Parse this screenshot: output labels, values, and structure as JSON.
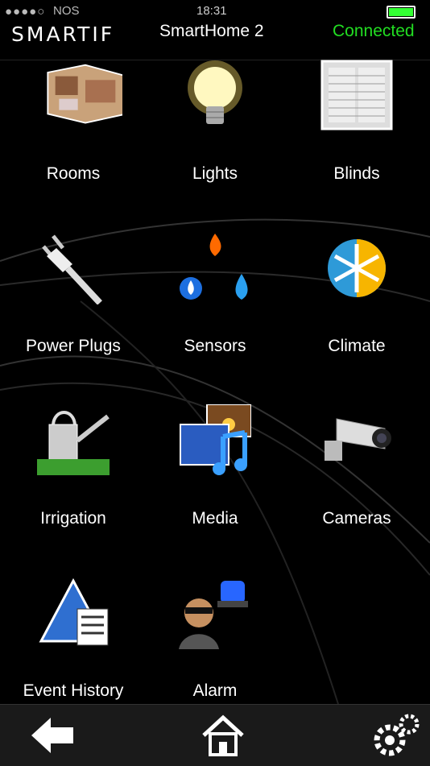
{
  "status_bar": {
    "signal": "●●●●○",
    "carrier": "NOS",
    "time": "18:31"
  },
  "header": {
    "logo": "SMARTIF",
    "title": "SmartHome 2",
    "connection": "Connected"
  },
  "tiles": [
    {
      "label": "Rooms",
      "icon": "floorplan-icon"
    },
    {
      "label": "Lights",
      "icon": "lightbulb-icon"
    },
    {
      "label": "Blinds",
      "icon": "window-blinds-icon"
    },
    {
      "label": "Power Plugs",
      "icon": "power-plug-icon"
    },
    {
      "label": "Sensors",
      "icon": "sensors-icon"
    },
    {
      "label": "Climate",
      "icon": "climate-icon"
    },
    {
      "label": "Irrigation",
      "icon": "watering-can-icon"
    },
    {
      "label": "Media",
      "icon": "media-icon"
    },
    {
      "label": "Cameras",
      "icon": "security-camera-icon"
    },
    {
      "label": "Event History",
      "icon": "event-history-icon"
    },
    {
      "label": "Alarm",
      "icon": "alarm-icon"
    }
  ],
  "footer": {
    "back": "back-arrow-icon",
    "home": "home-icon",
    "settings": "gears-icon"
  },
  "colors": {
    "connected": "#22dd22",
    "background": "#000000"
  }
}
